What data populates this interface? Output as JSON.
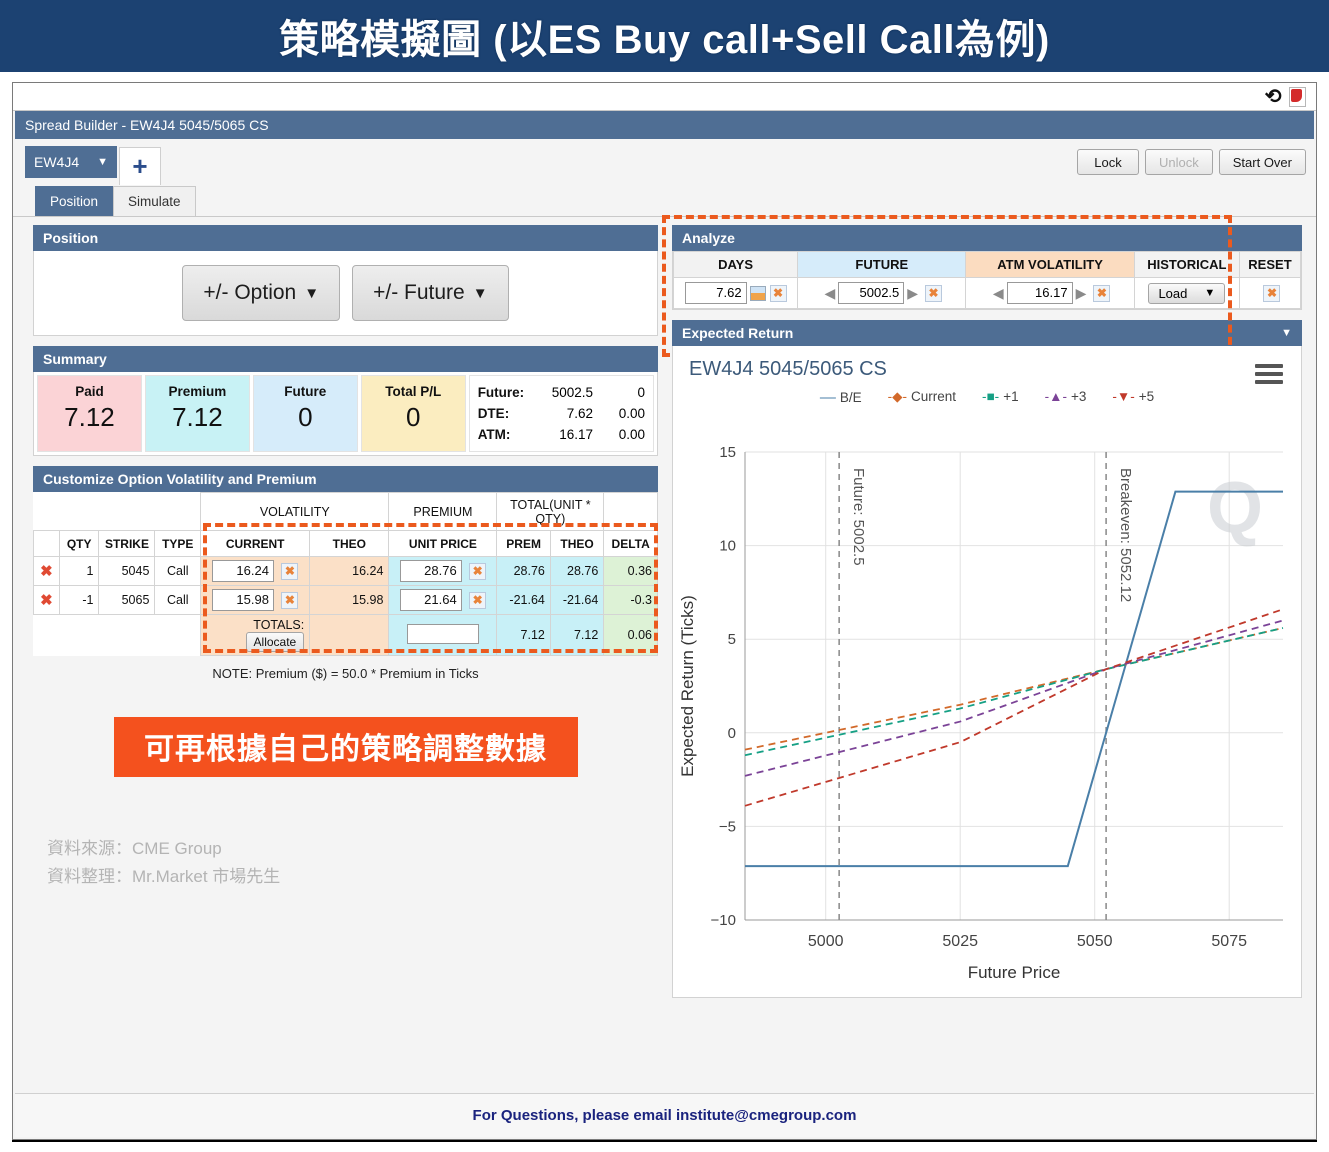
{
  "banner": {
    "title": "策略模擬圖 (以ES Buy call+Sell Call為例)"
  },
  "window": {
    "title_bar": "Spread Builder - EW4J4 5045/5065 CS",
    "refresh_icon": "refresh-icon",
    "pdf_icon": "pdf-icon"
  },
  "contract": {
    "selected": "EW4J4",
    "add_label": "+",
    "lock": "Lock",
    "unlock": "Unlock",
    "start_over": "Start Over"
  },
  "tabs": [
    {
      "label": "Position",
      "active": true
    },
    {
      "label": "Simulate",
      "active": false
    }
  ],
  "position": {
    "header": "Position",
    "option_button": "+/- Option",
    "future_button": "+/- Future"
  },
  "summary": {
    "header": "Summary",
    "cards": [
      {
        "label": "Paid",
        "value": "7.12"
      },
      {
        "label": "Premium",
        "value": "7.12"
      },
      {
        "label": "Future",
        "value": "0"
      },
      {
        "label": "Total P/L",
        "value": "0"
      }
    ],
    "rows": [
      {
        "key": "Future:",
        "v1": "5002.5",
        "v2": "0"
      },
      {
        "key": "DTE:",
        "v1": "7.62",
        "v2": "0.00"
      },
      {
        "key": "ATM:",
        "v1": "16.17",
        "v2": "0.00"
      }
    ]
  },
  "customize": {
    "header": "Customize Option Volatility and Premium",
    "group_headers": {
      "volatility": "VOLATILITY",
      "premium": "PREMIUM",
      "total": "TOTAL(UNIT * QTY)"
    },
    "columns": [
      "QTY",
      "STRIKE",
      "TYPE",
      "CURRENT",
      "THEO",
      "UNIT PRICE",
      "PREM",
      "THEO",
      "DELTA"
    ],
    "rows": [
      {
        "qty": "1",
        "strike": "5045",
        "type": "Call",
        "vol_current": "16.24",
        "vol_theo": "16.24",
        "unit_price": "28.76",
        "prem": "28.76",
        "total_theo": "28.76",
        "delta": "0.36"
      },
      {
        "qty": "-1",
        "strike": "5065",
        "type": "Call",
        "vol_current": "15.98",
        "vol_theo": "15.98",
        "unit_price": "21.64",
        "prem": "-21.64",
        "total_theo": "-21.64",
        "delta": "-0.3"
      }
    ],
    "totals": {
      "label": "TOTALS:",
      "allocate": "Allocate",
      "unit_price": "",
      "prem": "7.12",
      "theo": "7.12",
      "delta": "0.06"
    },
    "note": "NOTE: Premium ($) = 50.0 * Premium in Ticks"
  },
  "caption": {
    "text": "可再根據自己的策略調整數據"
  },
  "credits": {
    "line1": "資料來源：CME Group",
    "line2": "資料整理：Mr.Market 市場先生"
  },
  "analyze": {
    "header": "Analyze",
    "columns": [
      "DAYS",
      "FUTURE",
      "ATM VOLATILITY",
      "HISTORICAL",
      "RESET"
    ],
    "days_value": "7.62",
    "future_value": "5002.5",
    "atm_value": "16.17",
    "historical_label": "Load",
    "reset_icon": "clear-icon"
  },
  "expected_return": {
    "header": "Expected Return",
    "collapse_icon": "chevron-down-icon",
    "menu_icon": "hamburger-menu-icon"
  },
  "footer": {
    "text": "For Questions, please email institute@cmegroup.com"
  },
  "colors": {
    "banner_bg": "#1c4272",
    "panel_header": "#4f6e94",
    "accent_orange": "#eb5a1e",
    "caption_bg": "#f4511e",
    "be_line": "#4a7fa8",
    "current_line": "#d2692a",
    "plus1_line": "#16a085",
    "plus3_line": "#7b4397",
    "plus5_line": "#c0392b"
  },
  "chart_data": {
    "type": "line",
    "title": "EW4J4 5045/5065 CS",
    "xlabel": "Future Price",
    "ylabel": "Expected Return (Ticks)",
    "xlim": [
      4985,
      5085
    ],
    "ylim": [
      -10,
      15
    ],
    "yticks": [
      -10,
      -5,
      0,
      5,
      10,
      15
    ],
    "xticks": [
      5000,
      5025,
      5050,
      5075
    ],
    "grid": true,
    "legend_position": "top-center",
    "legend": [
      "B/E",
      "Current",
      "+1",
      "+3",
      "+5"
    ],
    "annotations": [
      {
        "label": "Future: 5002.5",
        "x": 5002.5,
        "type": "vline"
      },
      {
        "label": "Breakeven: 5052.12",
        "x": 5052.12,
        "type": "vline"
      }
    ],
    "series": [
      {
        "name": "B/E",
        "style": "solid",
        "color": "#4a7fa8",
        "x": [
          4985,
          5045,
          5065,
          5085
        ],
        "y": [
          -7.12,
          -7.12,
          12.88,
          12.88
        ]
      },
      {
        "name": "Current",
        "style": "dashed",
        "color": "#d2692a",
        "x": [
          4985,
          5025,
          5052.12,
          5085
        ],
        "y": [
          -0.9,
          1.5,
          3.4,
          5.6
        ]
      },
      {
        "name": "+1",
        "style": "dashed",
        "color": "#16a085",
        "x": [
          4985,
          5025,
          5052.12,
          5085
        ],
        "y": [
          -1.2,
          1.3,
          3.4,
          5.6
        ]
      },
      {
        "name": "+3",
        "style": "dashed",
        "color": "#7b4397",
        "x": [
          4985,
          5025,
          5052.12,
          5085
        ],
        "y": [
          -2.3,
          0.6,
          3.4,
          6.0
        ]
      },
      {
        "name": "+5",
        "style": "dashed",
        "color": "#c0392b",
        "x": [
          4985,
          5025,
          5052.12,
          5085
        ],
        "y": [
          -3.9,
          -0.5,
          3.4,
          6.6
        ]
      }
    ]
  }
}
